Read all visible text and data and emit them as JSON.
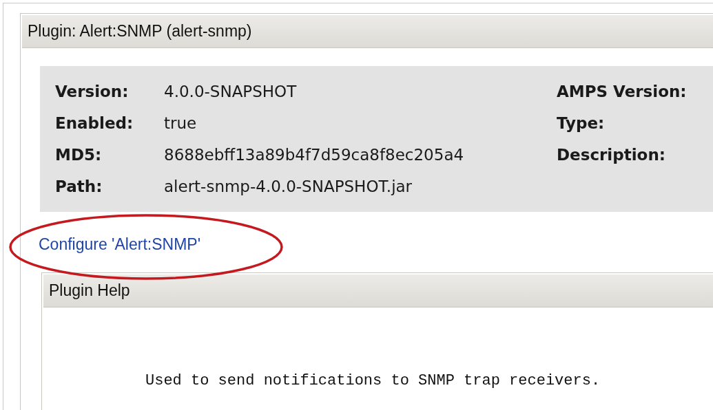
{
  "plugin_panel": {
    "title": "Plugin: Alert:SNMP (alert-snmp)",
    "details_left": [
      {
        "label": "Version:",
        "value": "4.0.0-SNAPSHOT"
      },
      {
        "label": "Enabled:",
        "value": "true"
      },
      {
        "label": "MD5:",
        "value": "8688ebff13a89b4f7d59ca8f8ec205a4"
      },
      {
        "label": "Path:",
        "value": "alert-snmp-4.0.0-SNAPSHOT.jar"
      }
    ],
    "details_right": [
      {
        "label": "AMPS Version:"
      },
      {
        "label": "Type:"
      },
      {
        "label": "Description:"
      }
    ],
    "configure_link": {
      "text": "Configure 'Alert:SNMP'",
      "highlighted": true
    },
    "help_panel": {
      "title": "Plugin Help",
      "text": "Used to send notifications to SNMP trap receivers."
    }
  }
}
